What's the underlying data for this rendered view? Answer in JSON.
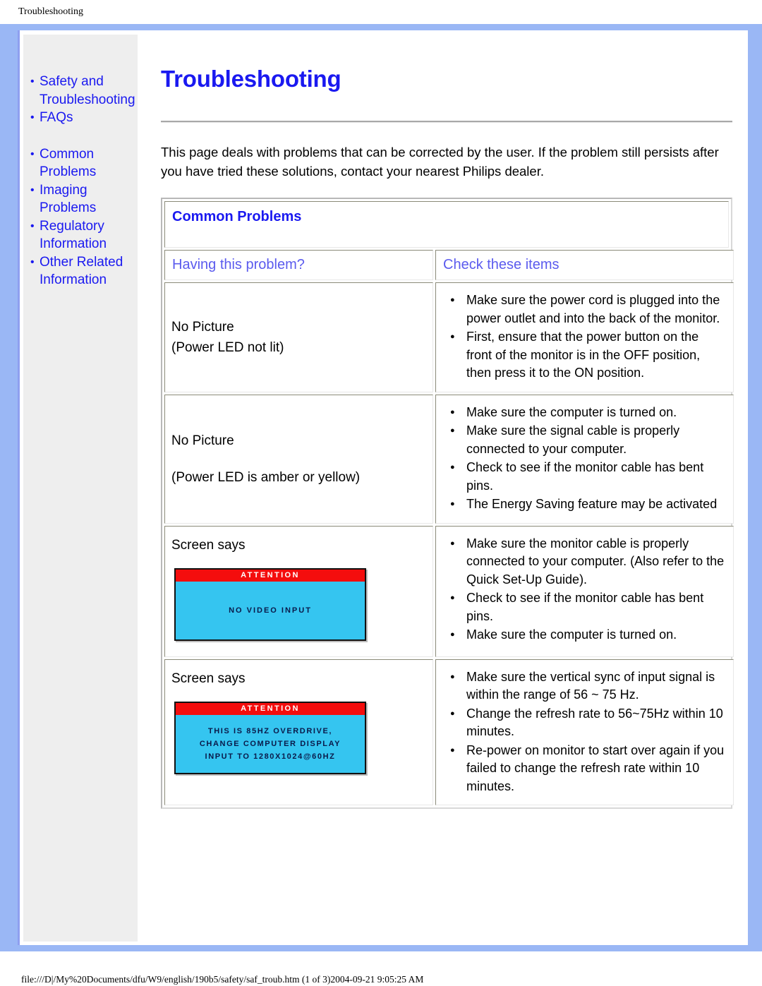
{
  "running_header": "Troubleshooting",
  "running_footer": "file:///D|/My%20Documents/dfu/W9/english/190b5/safety/saf_troub.htm (1 of 3)2004-09-21 9:05:25 AM",
  "colors": {
    "page_frame": "#9ab7f5",
    "link_blue": "#1a19f0",
    "heading_blue": "#1a19f0",
    "column_head_blue": "#5b5bee",
    "sidebar_bg": "#eeeeee",
    "osd_attention_bar": "#f40d0d",
    "osd_screen": "#35c5f0",
    "osd_text": "#0a1a4a"
  },
  "sidebar": {
    "group1": [
      {
        "label": "Safety and Troubleshooting"
      },
      {
        "label": "FAQs"
      }
    ],
    "group2": [
      {
        "label": "Common Problems"
      },
      {
        "label": "Imaging Problems"
      },
      {
        "label": "Regulatory Information"
      },
      {
        "label": "Other Related Information"
      }
    ]
  },
  "main": {
    "title": "Troubleshooting",
    "intro": "This page deals with problems that can be corrected by the user. If the problem still persists after you have tried these solutions, contact your nearest Philips dealer.",
    "table": {
      "caption": "Common Problems",
      "col_headers": {
        "left": "Having this problem?",
        "right": "Check these items"
      },
      "rows": [
        {
          "problem": "No Picture",
          "problem_sub": "(Power LED not lit)",
          "sub_spaced": false,
          "osd": null,
          "checks": [
            "Make sure the power cord is plugged into the power outlet and into the back of the monitor.",
            "First, ensure that the power button on the front of the monitor is in the OFF position, then press it to the ON position."
          ]
        },
        {
          "problem": "No Picture",
          "problem_sub": "(Power LED is amber or yellow)",
          "sub_spaced": true,
          "osd": null,
          "checks": [
            "Make sure the computer is turned on.",
            "Make sure the signal cable is properly connected to your computer.",
            "Check to see if the monitor cable has bent pins.",
            "The Energy Saving feature may be activated"
          ]
        },
        {
          "problem": "Screen says",
          "problem_sub": "",
          "sub_spaced": false,
          "osd": {
            "bar": "ATTENTION",
            "lines": [
              "NO VIDEO INPUT"
            ]
          },
          "checks": [
            "Make sure the monitor cable is properly connected to your computer. (Also refer to the Quick Set-Up Guide).",
            "Check to see if the monitor cable has bent pins.",
            "Make sure the computer is turned on."
          ]
        },
        {
          "problem": "Screen says",
          "problem_sub": "",
          "sub_spaced": false,
          "osd": {
            "bar": "ATTENTION",
            "lines": [
              "THIS IS 85HZ OVERDRIVE,",
              "CHANGE COMPUTER DISPLAY",
              "INPUT TO 1280X1024@60HZ"
            ]
          },
          "checks": [
            "Make sure the vertical sync of input signal is within the range of 56 ~ 75 Hz.",
            "Change the refresh rate to 56~75Hz within 10 minutes.",
            "Re-power on monitor to start over again if you failed to change the refresh rate within 10 minutes."
          ]
        }
      ]
    }
  }
}
